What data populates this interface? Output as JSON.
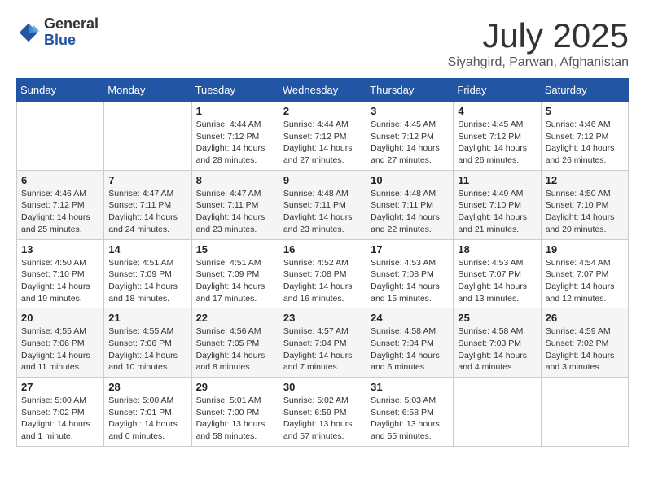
{
  "header": {
    "logo_general": "General",
    "logo_blue": "Blue",
    "month_title": "July 2025",
    "location": "Siyahgird, Parwan, Afghanistan"
  },
  "weekdays": [
    "Sunday",
    "Monday",
    "Tuesday",
    "Wednesday",
    "Thursday",
    "Friday",
    "Saturday"
  ],
  "weeks": [
    [
      {
        "day": "",
        "info": ""
      },
      {
        "day": "",
        "info": ""
      },
      {
        "day": "1",
        "info": "Sunrise: 4:44 AM\nSunset: 7:12 PM\nDaylight: 14 hours and 28 minutes."
      },
      {
        "day": "2",
        "info": "Sunrise: 4:44 AM\nSunset: 7:12 PM\nDaylight: 14 hours and 27 minutes."
      },
      {
        "day": "3",
        "info": "Sunrise: 4:45 AM\nSunset: 7:12 PM\nDaylight: 14 hours and 27 minutes."
      },
      {
        "day": "4",
        "info": "Sunrise: 4:45 AM\nSunset: 7:12 PM\nDaylight: 14 hours and 26 minutes."
      },
      {
        "day": "5",
        "info": "Sunrise: 4:46 AM\nSunset: 7:12 PM\nDaylight: 14 hours and 26 minutes."
      }
    ],
    [
      {
        "day": "6",
        "info": "Sunrise: 4:46 AM\nSunset: 7:12 PM\nDaylight: 14 hours and 25 minutes."
      },
      {
        "day": "7",
        "info": "Sunrise: 4:47 AM\nSunset: 7:11 PM\nDaylight: 14 hours and 24 minutes."
      },
      {
        "day": "8",
        "info": "Sunrise: 4:47 AM\nSunset: 7:11 PM\nDaylight: 14 hours and 23 minutes."
      },
      {
        "day": "9",
        "info": "Sunrise: 4:48 AM\nSunset: 7:11 PM\nDaylight: 14 hours and 23 minutes."
      },
      {
        "day": "10",
        "info": "Sunrise: 4:48 AM\nSunset: 7:11 PM\nDaylight: 14 hours and 22 minutes."
      },
      {
        "day": "11",
        "info": "Sunrise: 4:49 AM\nSunset: 7:10 PM\nDaylight: 14 hours and 21 minutes."
      },
      {
        "day": "12",
        "info": "Sunrise: 4:50 AM\nSunset: 7:10 PM\nDaylight: 14 hours and 20 minutes."
      }
    ],
    [
      {
        "day": "13",
        "info": "Sunrise: 4:50 AM\nSunset: 7:10 PM\nDaylight: 14 hours and 19 minutes."
      },
      {
        "day": "14",
        "info": "Sunrise: 4:51 AM\nSunset: 7:09 PM\nDaylight: 14 hours and 18 minutes."
      },
      {
        "day": "15",
        "info": "Sunrise: 4:51 AM\nSunset: 7:09 PM\nDaylight: 14 hours and 17 minutes."
      },
      {
        "day": "16",
        "info": "Sunrise: 4:52 AM\nSunset: 7:08 PM\nDaylight: 14 hours and 16 minutes."
      },
      {
        "day": "17",
        "info": "Sunrise: 4:53 AM\nSunset: 7:08 PM\nDaylight: 14 hours and 15 minutes."
      },
      {
        "day": "18",
        "info": "Sunrise: 4:53 AM\nSunset: 7:07 PM\nDaylight: 14 hours and 13 minutes."
      },
      {
        "day": "19",
        "info": "Sunrise: 4:54 AM\nSunset: 7:07 PM\nDaylight: 14 hours and 12 minutes."
      }
    ],
    [
      {
        "day": "20",
        "info": "Sunrise: 4:55 AM\nSunset: 7:06 PM\nDaylight: 14 hours and 11 minutes."
      },
      {
        "day": "21",
        "info": "Sunrise: 4:55 AM\nSunset: 7:06 PM\nDaylight: 14 hours and 10 minutes."
      },
      {
        "day": "22",
        "info": "Sunrise: 4:56 AM\nSunset: 7:05 PM\nDaylight: 14 hours and 8 minutes."
      },
      {
        "day": "23",
        "info": "Sunrise: 4:57 AM\nSunset: 7:04 PM\nDaylight: 14 hours and 7 minutes."
      },
      {
        "day": "24",
        "info": "Sunrise: 4:58 AM\nSunset: 7:04 PM\nDaylight: 14 hours and 6 minutes."
      },
      {
        "day": "25",
        "info": "Sunrise: 4:58 AM\nSunset: 7:03 PM\nDaylight: 14 hours and 4 minutes."
      },
      {
        "day": "26",
        "info": "Sunrise: 4:59 AM\nSunset: 7:02 PM\nDaylight: 14 hours and 3 minutes."
      }
    ],
    [
      {
        "day": "27",
        "info": "Sunrise: 5:00 AM\nSunset: 7:02 PM\nDaylight: 14 hours and 1 minute."
      },
      {
        "day": "28",
        "info": "Sunrise: 5:00 AM\nSunset: 7:01 PM\nDaylight: 14 hours and 0 minutes."
      },
      {
        "day": "29",
        "info": "Sunrise: 5:01 AM\nSunset: 7:00 PM\nDaylight: 13 hours and 58 minutes."
      },
      {
        "day": "30",
        "info": "Sunrise: 5:02 AM\nSunset: 6:59 PM\nDaylight: 13 hours and 57 minutes."
      },
      {
        "day": "31",
        "info": "Sunrise: 5:03 AM\nSunset: 6:58 PM\nDaylight: 13 hours and 55 minutes."
      },
      {
        "day": "",
        "info": ""
      },
      {
        "day": "",
        "info": ""
      }
    ]
  ]
}
